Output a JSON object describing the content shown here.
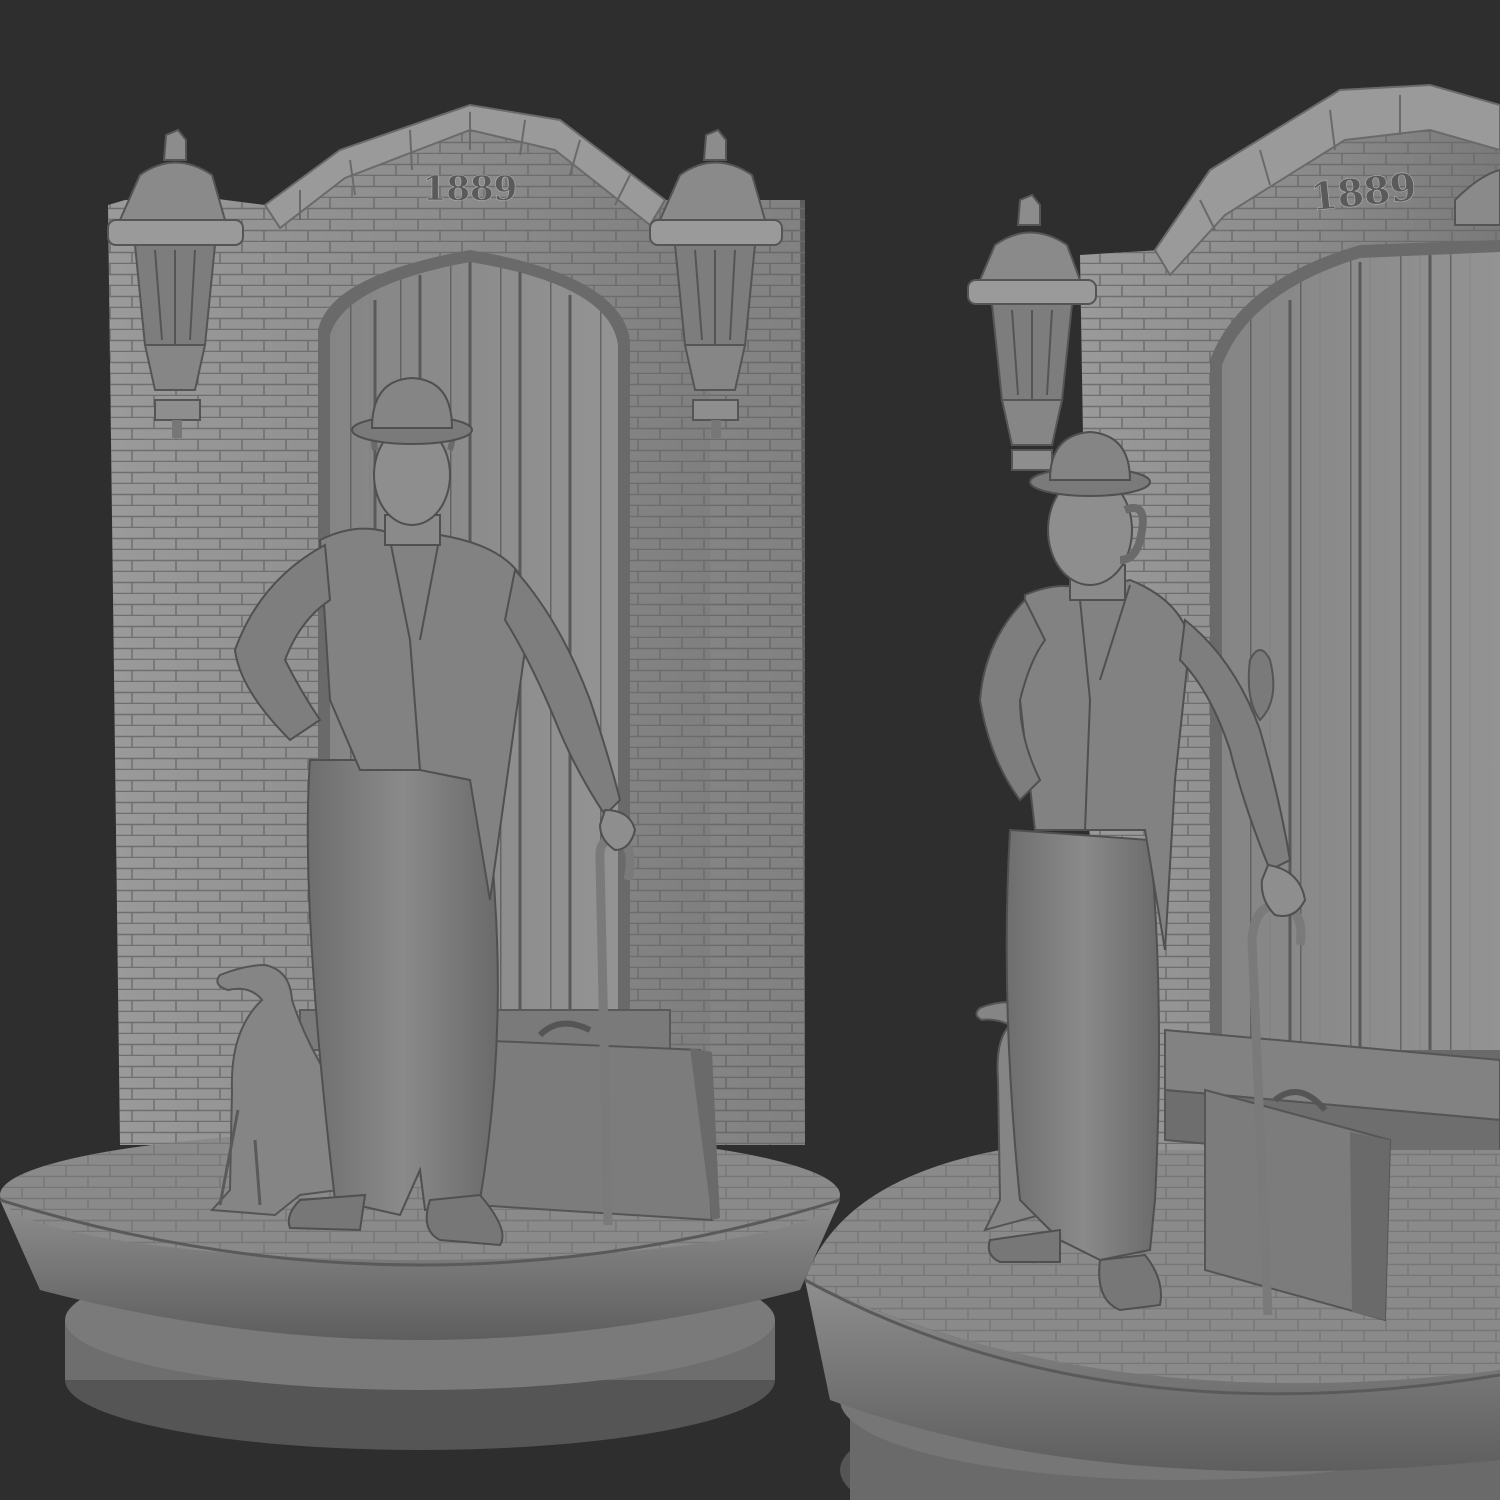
{
  "scene": {
    "background_color": "#2e2e2e",
    "clay_color": "#8a8a8a",
    "clay_dark": "#5c5c5c",
    "clay_light": "#a8a8a8",
    "left_view": {
      "year_text": "1889"
    },
    "right_view": {
      "year_text": "1889"
    }
  }
}
